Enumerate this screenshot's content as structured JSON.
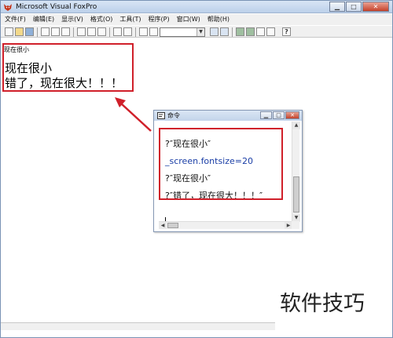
{
  "window": {
    "title": "Microsoft Visual FoxPro"
  },
  "menu": [
    "文件(F)",
    "编辑(E)",
    "显示(V)",
    "格式(O)",
    "工具(T)",
    "程序(P)",
    "窗口(W)",
    "帮助(H)"
  ],
  "toolbar": {
    "combo_value": "",
    "help_label": "?"
  },
  "screen": {
    "small_line": "现在很小",
    "big_lines": [
      "现在很小",
      "错了，现在很大！！！"
    ]
  },
  "command_window": {
    "title": "命令",
    "lines": [
      "?″现在很小″",
      "_screen.fontsize=20",
      "?″现在很小″",
      "?″错了，现在很大！！！″"
    ]
  },
  "watermark": "软件技巧",
  "colors": {
    "highlight": "#d0202a",
    "title_gradient_top": "#d8e5f5"
  },
  "icons": [
    "fox-app-icon",
    "minimize-icon",
    "maximize-icon",
    "close-icon",
    "command-window-icon",
    "help-icon"
  ]
}
